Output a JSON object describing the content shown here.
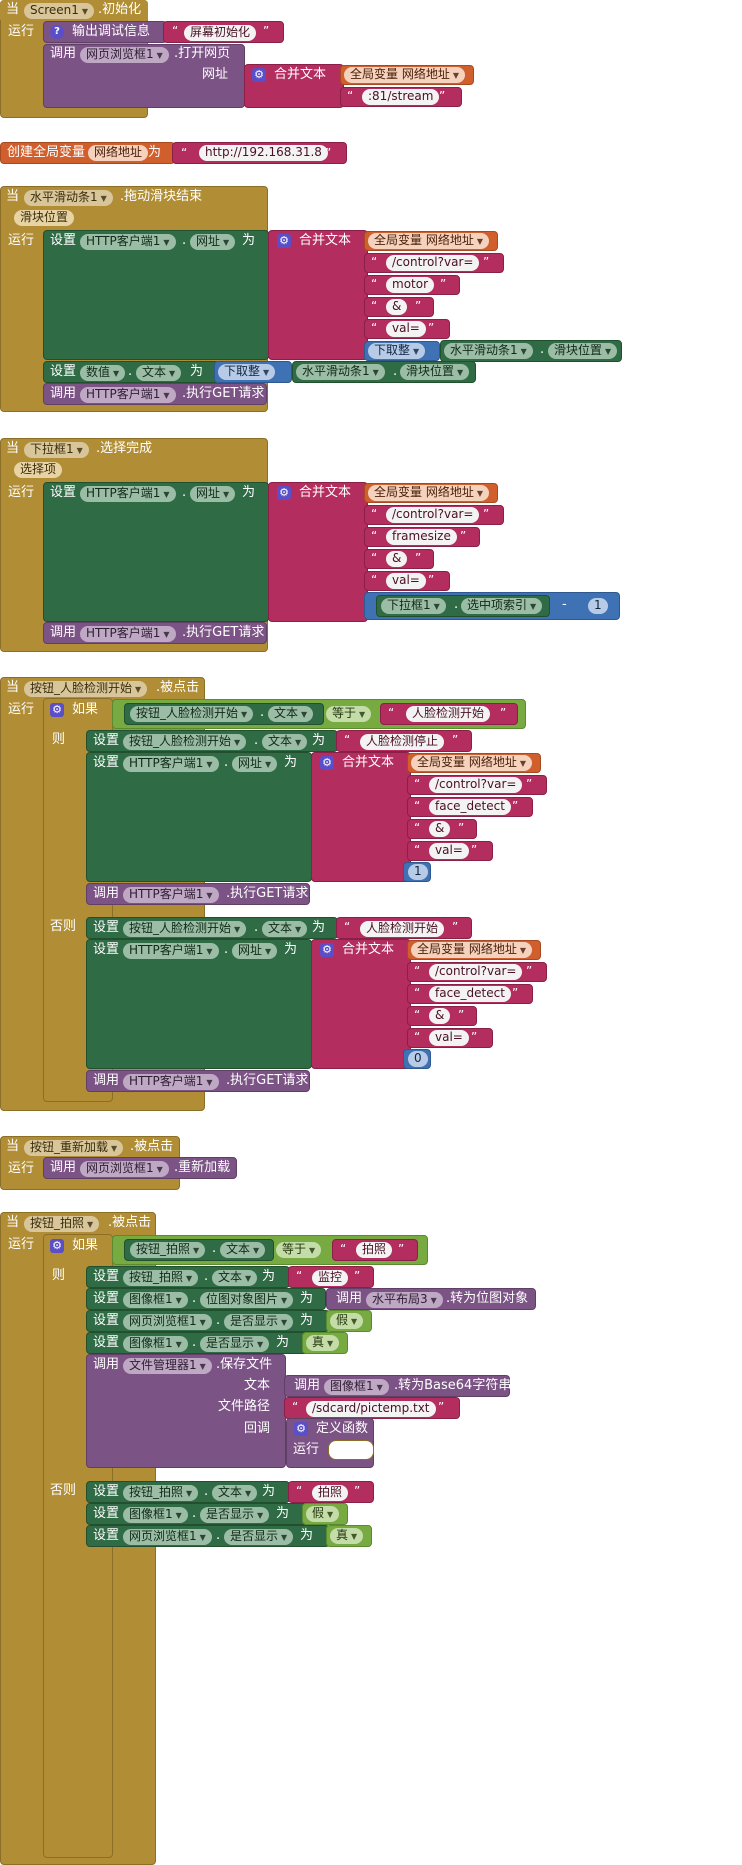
{
  "kw": {
    "when": "当",
    "run": "运行",
    "call": "调用",
    "set": "设置",
    "to": "为",
    "join": "合并文本",
    "if": "如果",
    "then": "则",
    "else": "否则",
    "url_label": "网址",
    "text_label": "文本",
    "path_label": "文件路径",
    "callback_label": "回调",
    "define_function": "定义函数",
    "global_var": "全局变量",
    "init_global": "创建全局变量",
    "minus": "-",
    "equals": "等于",
    "floor": "下取整",
    "true": "真",
    "false": "假",
    "dot": "."
  },
  "blocks": {
    "screen_init": {
      "component": "Screen1",
      "event": ".初始化",
      "log_label": "输出调试信息",
      "log_text": "屏幕初始化",
      "browser": "网页浏览框1",
      "method": ".打开网页",
      "var": "网络地址",
      "suffix": ":81/stream"
    },
    "global_var": {
      "name": "网络地址",
      "value": "http://192.168.31.8"
    },
    "slider": {
      "component": "水平滑动条1",
      "event": ".拖动滑块结束",
      "param": "滑块位置",
      "http": "HTTP客户端1",
      "prop": "网址",
      "var": "网络地址",
      "p1": "/control?var=",
      "p2": "motor",
      "p3": "&",
      "p4": "val=",
      "slider_prop": "滑块位置",
      "num_label": "数值",
      "text_prop": "文本",
      "get": ".执行GET请求"
    },
    "spinner": {
      "component": "下拉框1",
      "event": ".选择完成",
      "param": "选择项",
      "http": "HTTP客户端1",
      "prop": "网址",
      "var": "网络地址",
      "p1": "/control?var=",
      "p2": "framesize",
      "p3": "&",
      "p4": "val=",
      "spinner_prop": "选中项索引",
      "num": "1",
      "get": ".执行GET请求"
    },
    "face": {
      "component": "按钮_人脸检测开始",
      "event": ".被点击",
      "text_prop": "文本",
      "cmp_text": "人脸检测开始",
      "stop_text": "人脸检测停止",
      "http": "HTTP客户端1",
      "prop": "网址",
      "var": "网络地址",
      "p1": "/control?var=",
      "p2": "face_detect",
      "p3": "&",
      "p4": "val=",
      "on": "1",
      "off": "0",
      "start_text": "人脸检测开始",
      "get": ".执行GET请求"
    },
    "reload": {
      "component": "按钮_重新加载",
      "event": ".被点击",
      "browser": "网页浏览框1",
      "method": ".重新加载"
    },
    "photo": {
      "component": "按钮_拍照",
      "event": ".被点击",
      "text_prop": "文本",
      "cmp_text": "拍照",
      "monitor_text": "监控",
      "image": "图像框1",
      "pic_prop": "位图对象图片",
      "layout": "水平布局3",
      "to_bitmap": ".转为位图对象",
      "browser": "网页浏览框1",
      "visible": "是否显示",
      "file": "文件管理器1",
      "save": ".保存文件",
      "to_b64": ".转为Base64字符串",
      "path": "/sdcard/pictemp.txt",
      "photo_text": "拍照"
    }
  }
}
